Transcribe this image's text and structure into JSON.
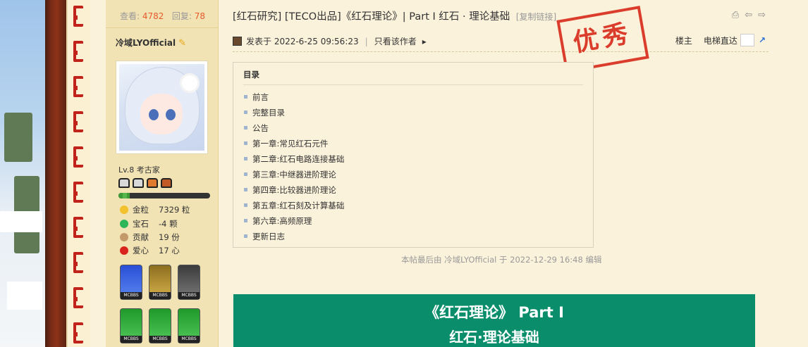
{
  "stats": {
    "views_label": "查看:",
    "views": "4782",
    "replies_label": "回复:",
    "replies": "78"
  },
  "thread": {
    "title": "[红石研究] [TECO出品]《红石理论》| Part I 红石 · 理论基础",
    "copy_link": "[复制链接]"
  },
  "user": {
    "name": "冷域LYOfficial",
    "level": "Lv.8 考古家",
    "xp_fraction": 0.12,
    "stats": [
      {
        "label": "金粒",
        "value": "7329 粒",
        "icon": "gold-nugget-icon",
        "color": "#f2c12e"
      },
      {
        "label": "宝石",
        "value": "-4 颗",
        "icon": "emerald-icon",
        "color": "#2fb55a"
      },
      {
        "label": "贡献",
        "value": "19 份",
        "icon": "cookie-icon",
        "color": "#c59a6a"
      },
      {
        "label": "爱心",
        "value": "17 心",
        "icon": "apple-icon",
        "color": "#d8241c"
      }
    ]
  },
  "post": {
    "posted": "发表于 2022-6-25 09:56:23",
    "author_only": "只看该作者",
    "floor": "楼主",
    "jump": "电梯直达",
    "stamp": "优秀"
  },
  "toc": {
    "title": "目录",
    "items": [
      "前言",
      "完整目录",
      "公告",
      "第一章:常见红石元件",
      "第二章:红石电路连接基础",
      "第三章:中继器进阶理论",
      "第四章:比较器进阶理论",
      "第五章:红石刻及计算基础",
      "第六章:高频原理",
      "更新日志"
    ]
  },
  "edit_note": "本帖最后由 冷域LYOfficial 于 2022-12-29 16:48 编辑",
  "banner": {
    "line1": "《红石理论》 Part I",
    "line2": "红石·理论基础"
  },
  "colors": {
    "accent_red": "#d82a1a",
    "banner_green": "#0a8d6b",
    "panel": "#f2e3b5",
    "page": "#fbf2db"
  }
}
